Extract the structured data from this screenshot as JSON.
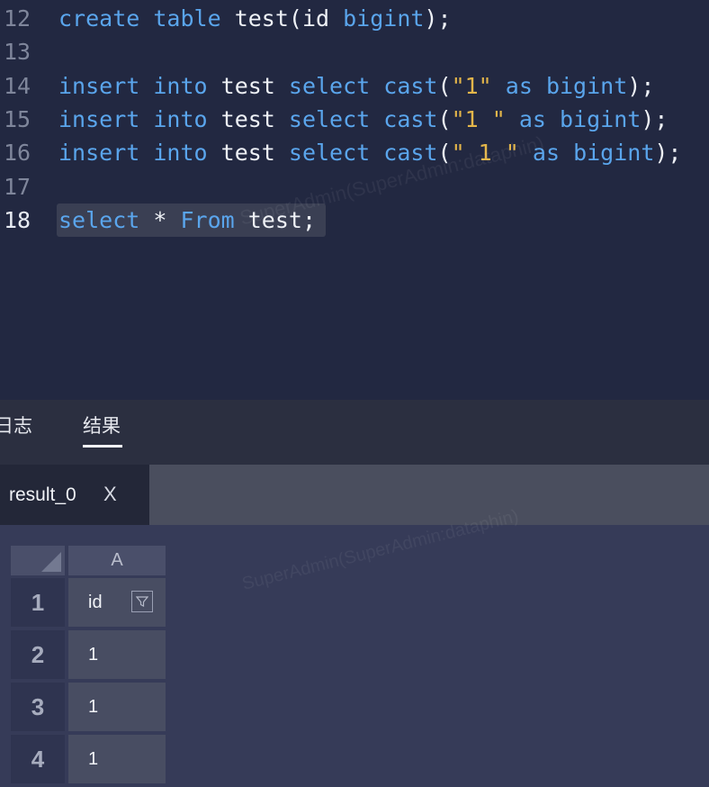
{
  "editor": {
    "lines": [
      {
        "num": "12",
        "tokens": [
          [
            "kw",
            "create"
          ],
          [
            "id",
            " "
          ],
          [
            "kw",
            "table"
          ],
          [
            "id",
            " test(id "
          ],
          [
            "kw",
            "bigint"
          ],
          [
            "id",
            ");"
          ]
        ]
      },
      {
        "num": "13",
        "tokens": []
      },
      {
        "num": "14",
        "tokens": [
          [
            "kw",
            "insert"
          ],
          [
            "id",
            " "
          ],
          [
            "kw",
            "into"
          ],
          [
            "id",
            " test "
          ],
          [
            "kw",
            "select"
          ],
          [
            "id",
            " "
          ],
          [
            "kw",
            "cast"
          ],
          [
            "id",
            "("
          ],
          [
            "str",
            "\"1\""
          ],
          [
            "id",
            " "
          ],
          [
            "kw",
            "as"
          ],
          [
            "id",
            " "
          ],
          [
            "kw",
            "bigint"
          ],
          [
            "id",
            ");"
          ]
        ]
      },
      {
        "num": "15",
        "tokens": [
          [
            "kw",
            "insert"
          ],
          [
            "id",
            " "
          ],
          [
            "kw",
            "into"
          ],
          [
            "id",
            " test "
          ],
          [
            "kw",
            "select"
          ],
          [
            "id",
            " "
          ],
          [
            "kw",
            "cast"
          ],
          [
            "id",
            "("
          ],
          [
            "str",
            "\"1 \""
          ],
          [
            "id",
            " "
          ],
          [
            "kw",
            "as"
          ],
          [
            "id",
            " "
          ],
          [
            "kw",
            "bigint"
          ],
          [
            "id",
            ");"
          ]
        ]
      },
      {
        "num": "16",
        "tokens": [
          [
            "kw",
            "insert"
          ],
          [
            "id",
            " "
          ],
          [
            "kw",
            "into"
          ],
          [
            "id",
            " test "
          ],
          [
            "kw",
            "select"
          ],
          [
            "id",
            " "
          ],
          [
            "kw",
            "cast"
          ],
          [
            "id",
            "("
          ],
          [
            "str",
            "\" 1 \""
          ],
          [
            "id",
            " "
          ],
          [
            "kw",
            "as"
          ],
          [
            "id",
            " "
          ],
          [
            "kw",
            "bigint"
          ],
          [
            "id",
            ");"
          ]
        ]
      },
      {
        "num": "17",
        "tokens": []
      },
      {
        "num": "18",
        "tokens": [
          [
            "kw",
            "select"
          ],
          [
            "id",
            " * "
          ],
          [
            "kw",
            "From"
          ],
          [
            "id",
            " test;"
          ]
        ]
      }
    ],
    "active_line": "18"
  },
  "panel": {
    "tabs": [
      "日志",
      "结果"
    ],
    "active_tab": "结果",
    "result_tab": {
      "label": "result_0",
      "close": "X"
    }
  },
  "grid": {
    "column_header": "A",
    "rows": [
      {
        "row": "1",
        "value": "id",
        "is_header": true
      },
      {
        "row": "2",
        "value": "1"
      },
      {
        "row": "3",
        "value": "1"
      },
      {
        "row": "4",
        "value": "1"
      }
    ]
  },
  "watermark_text": "SuperAdmin(SuperAdmin:dataphin)",
  "colors": {
    "keyword": "#5aa5ec",
    "string": "#e4b64a",
    "identifier": "#eef1f6",
    "background": "#222841"
  }
}
